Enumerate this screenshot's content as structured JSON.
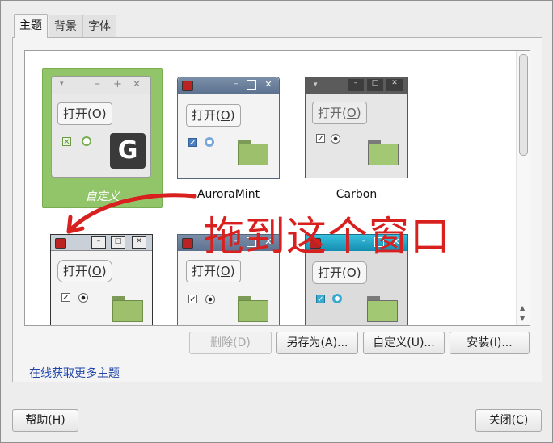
{
  "tabs": [
    "主题",
    "背景",
    "字体"
  ],
  "themes": [
    {
      "name": "自定义",
      "open_label": "打开",
      "open_key": "O",
      "selected": true
    },
    {
      "name": "AuroraMint",
      "open_label": "打开",
      "open_key": "O"
    },
    {
      "name": "Carbon",
      "open_label": "打开",
      "open_key": "O"
    },
    {
      "name": "",
      "open_label": "打开",
      "open_key": "O"
    },
    {
      "name": "",
      "open_label": "打开",
      "open_key": "O"
    },
    {
      "name": "",
      "open_label": "打开",
      "open_key": "O"
    }
  ],
  "annotation": "拖到这个窗口",
  "actions": {
    "delete": "删除(D)",
    "save_as": "另存为(A)...",
    "customize": "自定义(U)...",
    "install": "安装(I)..."
  },
  "more_themes_link": "在线获取更多主题",
  "footer": {
    "help": "帮助(H)",
    "close": "关闭(C)"
  },
  "colors": {
    "selected_bg": "#92c46a",
    "annotation": "#d8201f",
    "link": "#1f45a8"
  }
}
